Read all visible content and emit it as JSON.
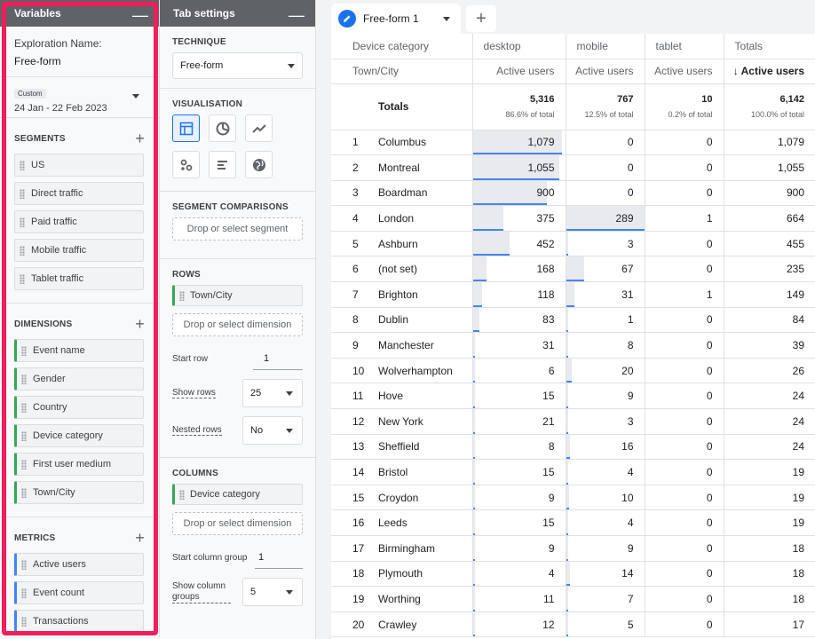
{
  "variables": {
    "title": "Variables",
    "exploration_name_label": "Exploration Name:",
    "exploration_name": "Free-form",
    "date_chip": "Custom",
    "date_range": "24 Jan - 22 Feb 2023",
    "segments_title": "SEGMENTS",
    "segments": [
      "US",
      "Direct traffic",
      "Paid traffic",
      "Mobile traffic",
      "Tablet traffic"
    ],
    "dimensions_title": "DIMENSIONS",
    "dimensions": [
      "Event name",
      "Gender",
      "Country",
      "Device category",
      "First user medium",
      "Town/City"
    ],
    "metrics_title": "METRICS",
    "metrics": [
      "Active users",
      "Event count",
      "Transactions"
    ]
  },
  "tab_settings": {
    "title": "Tab settings",
    "technique_title": "TECHNIQUE",
    "technique": "Free-form",
    "visualisation_title": "VISUALISATION",
    "segment_comparisons_title": "SEGMENT COMPARISONS",
    "segment_drop": "Drop or select segment",
    "rows_title": "ROWS",
    "rows_item": "Town/City",
    "rows_drop": "Drop or select dimension",
    "start_row_label": "Start row",
    "start_row": "1",
    "show_rows_label": "Show rows",
    "show_rows": "25",
    "nested_rows_label": "Nested rows",
    "nested_rows": "No",
    "columns_title": "COLUMNS",
    "columns_item": "Device category",
    "columns_drop": "Drop or select dimension",
    "start_column_group_label": "Start column group",
    "start_column_group": "1",
    "show_column_groups_label": "Show column groups",
    "show_column_groups": "5"
  },
  "canvas": {
    "tab_name": "Free-form 1",
    "add_tab": "+",
    "dim_header": "Device category",
    "row_header": "Town/City",
    "columns": [
      "desktop",
      "mobile",
      "tablet",
      "Totals"
    ],
    "metric": "Active users",
    "sorted_metric": "↓ Active users",
    "totals_label": "Totals",
    "totals": [
      {
        "value": "5,316",
        "pct": "86.6% of total"
      },
      {
        "value": "767",
        "pct": "12.5% of total"
      },
      {
        "value": "10",
        "pct": "0.2% of total"
      },
      {
        "value": "6,142",
        "pct": "100.0% of total"
      }
    ],
    "rows": [
      {
        "idx": "1",
        "city": "Columbus",
        "desktop": "1,079",
        "mobile": "0",
        "tablet": "0",
        "total": "1,079"
      },
      {
        "idx": "2",
        "city": "Montreal",
        "desktop": "1,055",
        "mobile": "0",
        "tablet": "0",
        "total": "1,055"
      },
      {
        "idx": "3",
        "city": "Boardman",
        "desktop": "900",
        "mobile": "0",
        "tablet": "0",
        "total": "900"
      },
      {
        "idx": "4",
        "city": "London",
        "desktop": "375",
        "mobile": "289",
        "tablet": "1",
        "total": "664"
      },
      {
        "idx": "5",
        "city": "Ashburn",
        "desktop": "452",
        "mobile": "3",
        "tablet": "0",
        "total": "455"
      },
      {
        "idx": "6",
        "city": "(not set)",
        "desktop": "168",
        "mobile": "67",
        "tablet": "0",
        "total": "235"
      },
      {
        "idx": "7",
        "city": "Brighton",
        "desktop": "118",
        "mobile": "31",
        "tablet": "1",
        "total": "149"
      },
      {
        "idx": "8",
        "city": "Dublin",
        "desktop": "83",
        "mobile": "1",
        "tablet": "0",
        "total": "84"
      },
      {
        "idx": "9",
        "city": "Manchester",
        "desktop": "31",
        "mobile": "8",
        "tablet": "0",
        "total": "39"
      },
      {
        "idx": "10",
        "city": "Wolverhampton",
        "desktop": "6",
        "mobile": "20",
        "tablet": "0",
        "total": "26"
      },
      {
        "idx": "11",
        "city": "Hove",
        "desktop": "15",
        "mobile": "9",
        "tablet": "0",
        "total": "24"
      },
      {
        "idx": "12",
        "city": "New York",
        "desktop": "21",
        "mobile": "3",
        "tablet": "0",
        "total": "24"
      },
      {
        "idx": "13",
        "city": "Sheffield",
        "desktop": "8",
        "mobile": "16",
        "tablet": "0",
        "total": "24"
      },
      {
        "idx": "14",
        "city": "Bristol",
        "desktop": "15",
        "mobile": "4",
        "tablet": "0",
        "total": "19"
      },
      {
        "idx": "15",
        "city": "Croydon",
        "desktop": "9",
        "mobile": "10",
        "tablet": "0",
        "total": "19"
      },
      {
        "idx": "16",
        "city": "Leeds",
        "desktop": "15",
        "mobile": "4",
        "tablet": "0",
        "total": "19"
      },
      {
        "idx": "17",
        "city": "Birmingham",
        "desktop": "9",
        "mobile": "9",
        "tablet": "0",
        "total": "18"
      },
      {
        "idx": "18",
        "city": "Plymouth",
        "desktop": "4",
        "mobile": "14",
        "tablet": "0",
        "total": "18"
      },
      {
        "idx": "19",
        "city": "Worthing",
        "desktop": "11",
        "mobile": "7",
        "tablet": "0",
        "total": "18"
      },
      {
        "idx": "20",
        "city": "Crawley",
        "desktop": "12",
        "mobile": "5",
        "tablet": "0",
        "total": "17"
      }
    ]
  },
  "colors": {
    "highlight_frame": "#ef1f5b",
    "bar_line": "#4285f4",
    "dimension_accent": "#34a853",
    "metric_accent": "#4285f4"
  }
}
